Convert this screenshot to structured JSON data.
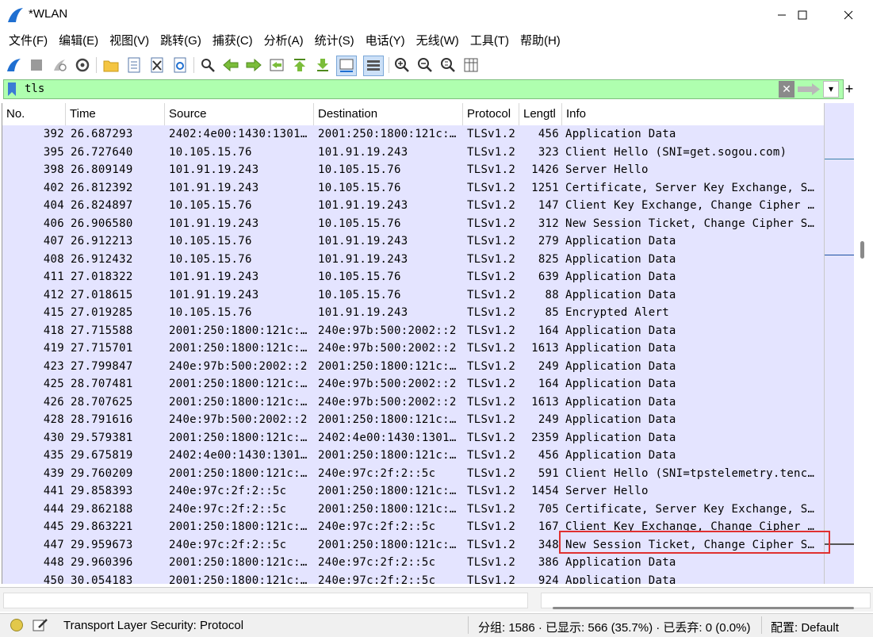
{
  "window": {
    "title": "*WLAN",
    "minimize_glyph": "—",
    "maximize_glyph": "☐",
    "close_glyph": "✕"
  },
  "menu": [
    "文件(F)",
    "编辑(E)",
    "视图(V)",
    "跳转(G)",
    "捕获(C)",
    "分析(A)",
    "统计(S)",
    "电话(Y)",
    "无线(W)",
    "工具(T)",
    "帮助(H)"
  ],
  "toolbar_icons": [
    "start-capture-icon",
    "stop-capture-icon",
    "restart-capture-icon",
    "capture-options-icon",
    "open-file-icon",
    "save-file-icon",
    "close-file-icon",
    "reload-file-icon",
    "find-packet-icon",
    "go-back-icon",
    "go-forward-icon",
    "go-to-packet-icon",
    "go-first-icon",
    "go-last-icon",
    "auto-scroll-icon",
    "colorize-icon",
    "zoom-in-icon",
    "zoom-out-icon",
    "normal-size-icon",
    "resize-columns-icon"
  ],
  "filter": {
    "value": "tls",
    "add_glyph": "+",
    "dropdown_glyph": "▾",
    "clear_glyph": "✕"
  },
  "columns": [
    "No.",
    "Time",
    "Source",
    "Destination",
    "Protocol",
    "Lengtl",
    "Info"
  ],
  "packets": [
    [
      "392",
      "26.687293",
      "2402:4e00:1430:1301…",
      "2001:250:1800:121c:…",
      "TLSv1.2",
      "456",
      "Application Data"
    ],
    [
      "395",
      "26.727640",
      "10.105.15.76",
      "101.91.19.243",
      "TLSv1.2",
      "323",
      "Client Hello (SNI=get.sogou.com)"
    ],
    [
      "398",
      "26.809149",
      "101.91.19.243",
      "10.105.15.76",
      "TLSv1.2",
      "1426",
      "Server Hello"
    ],
    [
      "402",
      "26.812392",
      "101.91.19.243",
      "10.105.15.76",
      "TLSv1.2",
      "1251",
      "Certificate, Server Key Exchange, S…"
    ],
    [
      "404",
      "26.824897",
      "10.105.15.76",
      "101.91.19.243",
      "TLSv1.2",
      "147",
      "Client Key Exchange, Change Cipher …"
    ],
    [
      "406",
      "26.906580",
      "101.91.19.243",
      "10.105.15.76",
      "TLSv1.2",
      "312",
      "New Session Ticket, Change Cipher S…"
    ],
    [
      "407",
      "26.912213",
      "10.105.15.76",
      "101.91.19.243",
      "TLSv1.2",
      "279",
      "Application Data"
    ],
    [
      "408",
      "26.912432",
      "10.105.15.76",
      "101.91.19.243",
      "TLSv1.2",
      "825",
      "Application Data"
    ],
    [
      "411",
      "27.018322",
      "101.91.19.243",
      "10.105.15.76",
      "TLSv1.2",
      "639",
      "Application Data"
    ],
    [
      "412",
      "27.018615",
      "101.91.19.243",
      "10.105.15.76",
      "TLSv1.2",
      "88",
      "Application Data"
    ],
    [
      "415",
      "27.019285",
      "10.105.15.76",
      "101.91.19.243",
      "TLSv1.2",
      "85",
      "Encrypted Alert"
    ],
    [
      "418",
      "27.715588",
      "2001:250:1800:121c:…",
      "240e:97b:500:2002::2",
      "TLSv1.2",
      "164",
      "Application Data"
    ],
    [
      "419",
      "27.715701",
      "2001:250:1800:121c:…",
      "240e:97b:500:2002::2",
      "TLSv1.2",
      "1613",
      "Application Data"
    ],
    [
      "423",
      "27.799847",
      "240e:97b:500:2002::2",
      "2001:250:1800:121c:…",
      "TLSv1.2",
      "249",
      "Application Data"
    ],
    [
      "425",
      "28.707481",
      "2001:250:1800:121c:…",
      "240e:97b:500:2002::2",
      "TLSv1.2",
      "164",
      "Application Data"
    ],
    [
      "426",
      "28.707625",
      "2001:250:1800:121c:…",
      "240e:97b:500:2002::2",
      "TLSv1.2",
      "1613",
      "Application Data"
    ],
    [
      "428",
      "28.791616",
      "240e:97b:500:2002::2",
      "2001:250:1800:121c:…",
      "TLSv1.2",
      "249",
      "Application Data"
    ],
    [
      "430",
      "29.579381",
      "2001:250:1800:121c:…",
      "2402:4e00:1430:1301…",
      "TLSv1.2",
      "2359",
      "Application Data"
    ],
    [
      "435",
      "29.675819",
      "2402:4e00:1430:1301…",
      "2001:250:1800:121c:…",
      "TLSv1.2",
      "456",
      "Application Data"
    ],
    [
      "439",
      "29.760209",
      "2001:250:1800:121c:…",
      "240e:97c:2f:2::5c",
      "TLSv1.2",
      "591",
      "Client Hello (SNI=tpstelemetry.tenc…"
    ],
    [
      "441",
      "29.858393",
      "240e:97c:2f:2::5c",
      "2001:250:1800:121c:…",
      "TLSv1.2",
      "1454",
      "Server Hello"
    ],
    [
      "444",
      "29.862188",
      "240e:97c:2f:2::5c",
      "2001:250:1800:121c:…",
      "TLSv1.2",
      "705",
      "Certificate, Server Key Exchange, S…"
    ],
    [
      "445",
      "29.863221",
      "2001:250:1800:121c:…",
      "240e:97c:2f:2::5c",
      "TLSv1.2",
      "167",
      "Client Key Exchange, Change Cipher …"
    ],
    [
      "447",
      "29.959673",
      "240e:97c:2f:2::5c",
      "2001:250:1800:121c:…",
      "TLSv1.2",
      "348",
      "New Session Ticket, Change Cipher S…"
    ],
    [
      "448",
      "29.960396",
      "2001:250:1800:121c:…",
      "240e:97c:2f:2::5c",
      "TLSv1.2",
      "386",
      "Application Data"
    ],
    [
      "450",
      "30.054183",
      "2001:250:1800:121c:…",
      "240e:97c:2f:2::5c",
      "TLSv1.2",
      "924",
      "Application Data"
    ]
  ],
  "highlighted_packet": "447",
  "status": {
    "left_text": "Transport Layer Security: Protocol",
    "packets_text": "分组: 1586 · 已显示: 566 (35.7%) · 已丢弃: 0 (0.0%)",
    "profile_text": "配置: Default"
  },
  "colors": {
    "row_bg": "#e4e4ff",
    "filter_bg": "#afffaf",
    "highlight": "#e03030",
    "accent": "#1f6fd1"
  }
}
